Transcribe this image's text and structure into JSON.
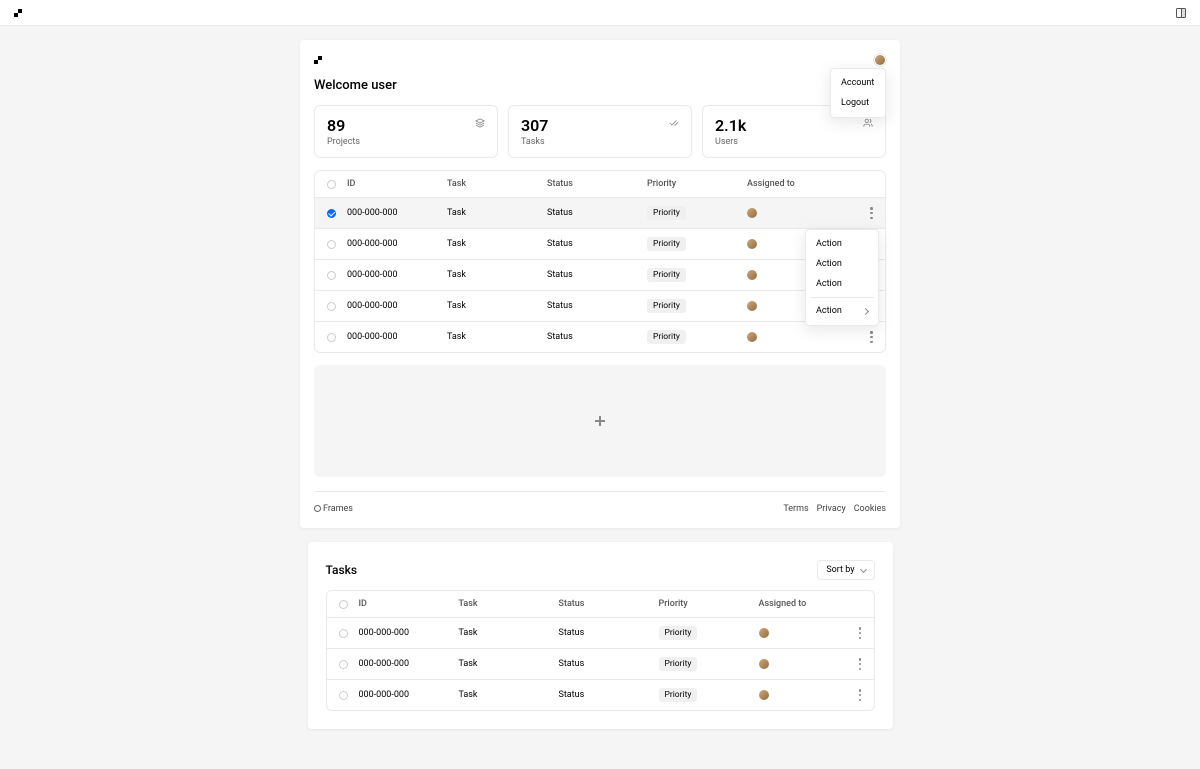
{
  "welcome": "Welcome user",
  "userMenu": {
    "account": "Account",
    "logout": "Logout"
  },
  "stats": [
    {
      "value": "89",
      "label": "Projects"
    },
    {
      "value": "307",
      "label": "Tasks"
    },
    {
      "value": "2.1k",
      "label": "Users"
    }
  ],
  "columns": {
    "id": "ID",
    "task": "Task",
    "status": "Status",
    "priority": "Priority",
    "assigned": "Assigned to"
  },
  "rows": [
    {
      "id": "000-000-000",
      "task": "Task",
      "status": "Status",
      "priority": "Priority"
    },
    {
      "id": "000-000-000",
      "task": "Task",
      "status": "Status",
      "priority": "Priority"
    },
    {
      "id": "000-000-000",
      "task": "Task",
      "status": "Status",
      "priority": "Priority"
    },
    {
      "id": "000-000-000",
      "task": "Task",
      "status": "Status",
      "priority": "Priority"
    },
    {
      "id": "000-000-000",
      "task": "Task",
      "status": "Status",
      "priority": "Priority"
    }
  ],
  "actions": {
    "a1": "Action",
    "a2": "Action",
    "a3": "Action",
    "a4": "Action"
  },
  "footer": {
    "copyright": "Frames",
    "terms": "Terms",
    "privacy": "Privacy",
    "cookies": "Cookies"
  },
  "section2": {
    "title": "Tasks",
    "sort": "Sort by"
  },
  "rows2": [
    {
      "id": "000-000-000",
      "task": "Task",
      "status": "Status",
      "priority": "Priority"
    },
    {
      "id": "000-000-000",
      "task": "Task",
      "status": "Status",
      "priority": "Priority"
    },
    {
      "id": "000-000-000",
      "task": "Task",
      "status": "Status",
      "priority": "Priority"
    }
  ]
}
